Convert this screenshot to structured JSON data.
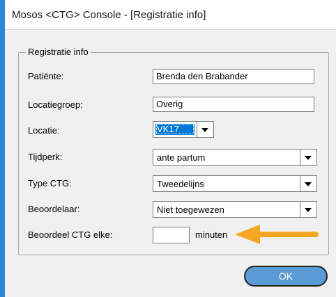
{
  "window": {
    "title": "Mosos <CTG> Console - [Registratie info]"
  },
  "group": {
    "legend": "Registratie info"
  },
  "fields": {
    "patient": {
      "label": "Patiënte:",
      "value": "Brenda den Brabander"
    },
    "locatiegroep": {
      "label": "Locatiegroep:",
      "value": "Overig"
    },
    "locatie": {
      "label": "Locatie:",
      "value": "VK17"
    },
    "tijdperk": {
      "label": "Tijdperk:",
      "value": "ante partum"
    },
    "type_ctg": {
      "label": "Type CTG:",
      "value": "Tweedelijns"
    },
    "beoordelaar": {
      "label": "Beoordelaar:",
      "value": "Niet toegewezen"
    },
    "beoordeel": {
      "label": "Beoordeel CTG elke:",
      "value": "",
      "unit": "minuten"
    }
  },
  "buttons": {
    "ok": "OK"
  },
  "annotation": {
    "arrow_color": "#f5a623",
    "icon": "left-arrow-icon"
  },
  "colors": {
    "accent": "#2b88d8",
    "selection": "#0078d7",
    "button": "#5b9bd5"
  }
}
